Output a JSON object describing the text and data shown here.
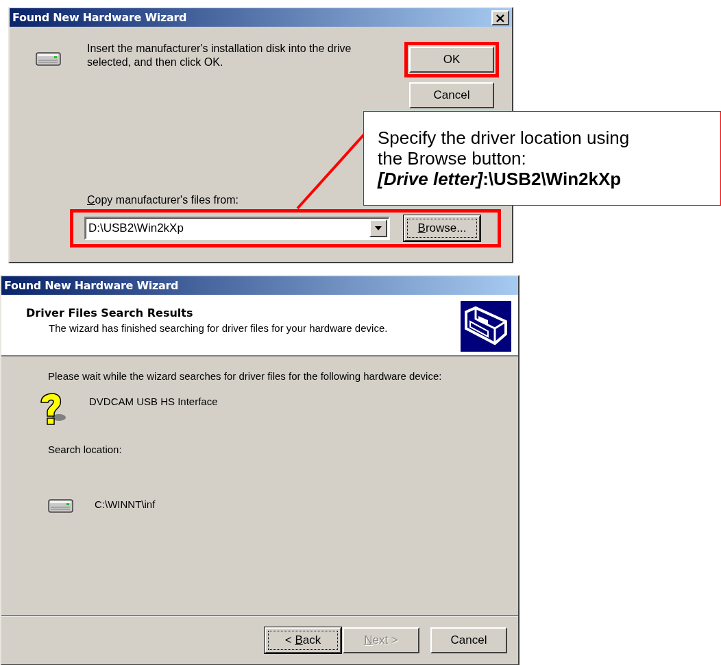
{
  "insert_dialog": {
    "title": "Found New Hardware Wizard",
    "close": "×",
    "message": "Insert the manufacturer's installation disk into the drive selected, and then click OK.",
    "buttons": [
      {
        "label": "OK",
        "highlighted": true
      },
      {
        "label": "Cancel",
        "highlighted": false
      }
    ],
    "source": {
      "label": {
        "key": "C",
        "post": "opy manufacturer's files from:"
      },
      "value": "D:\\USB2\\Win2kXp",
      "highlighted": true,
      "browse": {
        "label": {
          "key": "B",
          "post": "rowse..."
        }
      }
    }
  },
  "callout": {
    "text": "Specify the driver location using the Browse button:",
    "path": "*[Drive letter]*:\\USB2\\Win2kXp"
  },
  "results_dialog": {
    "title": "Found New Hardware Wizard",
    "heading": "Driver Files Search Results",
    "subheading": "The wizard has finished searching for driver files for your hardware device.",
    "intro": "Please wait while the wizard searches for driver files for the following hardware device:",
    "device": "DVDCAM USB HS Interface",
    "location_label": "Search location:",
    "location": "C:\\WINNT\\inf",
    "buttons": [
      {
        "label": {
          "pre": "< ",
          "key": "B",
          "post": "ack"
        },
        "focused": true,
        "disabled": false
      },
      {
        "label": {
          "key": "N",
          "post": "ext >"
        },
        "focused": false,
        "disabled": true
      },
      {
        "label": {
          "pre": "Cancel"
        },
        "focused": false,
        "disabled": false
      }
    ]
  }
}
